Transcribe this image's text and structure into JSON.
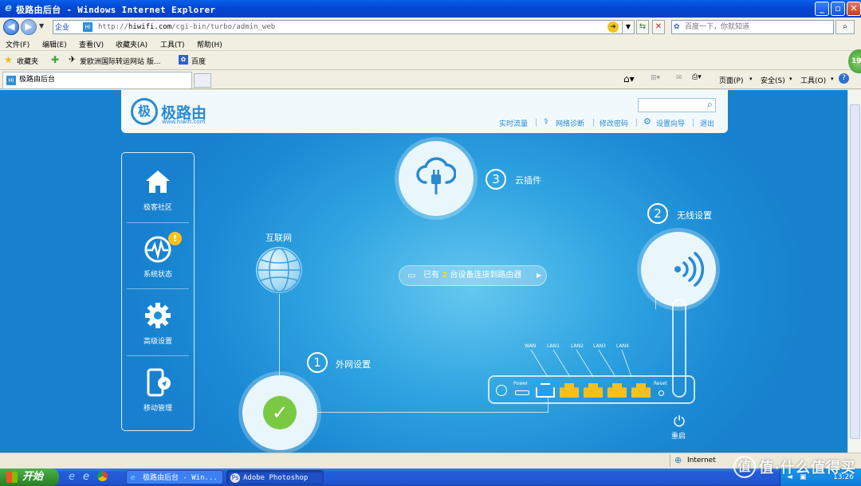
{
  "window": {
    "title": "极路由后台 - Windows Internet Explorer"
  },
  "address": {
    "zone": "企业",
    "url_prefix": "http://",
    "url_host": "hiwifi.com",
    "url_path": "/cgi-bin/turbo/admin_web",
    "search_placeholder": "百度一下，你就知道"
  },
  "menu": [
    "文件(F)",
    "编辑(E)",
    "查看(V)",
    "收藏夹(A)",
    "工具(T)",
    "帮助(H)"
  ],
  "favorites": {
    "label": "收藏夹",
    "items": [
      "爱欧洲国际转运网站 版...",
      "百度"
    ]
  },
  "tab": {
    "title": "极路由后台"
  },
  "commandbar": [
    "页面(P)",
    "安全(S)",
    "工具(O)"
  ],
  "page": {
    "brand": "极路由",
    "brand_url": "www.hiwifi.com",
    "header_links": [
      "实时流量",
      "网络诊断",
      "修改密码",
      "设置向导",
      "退出"
    ],
    "sidebar": [
      {
        "label": "极客社区",
        "icon": "home-icon"
      },
      {
        "label": "系统状态",
        "icon": "status-monitor-icon"
      },
      {
        "label": "高级设置",
        "icon": "gear-icon"
      },
      {
        "label": "移动管理",
        "icon": "mobile-icon"
      }
    ],
    "steps": [
      {
        "num": "1",
        "label": "外网设置"
      },
      {
        "num": "2",
        "label": "无线设置"
      },
      {
        "num": "3",
        "label": "云插件"
      }
    ],
    "internet_label": "互联网",
    "devices_text_before": "已有",
    "devices_count": "2",
    "devices_text_after": "台设备连接到路由器",
    "router": {
      "power": "Power",
      "reset": "Reset",
      "ports": [
        "WAN",
        "LAN1",
        "LAN2",
        "LAN3",
        "LAN4"
      ]
    },
    "restart_label": "重启",
    "colors": {
      "background": "#1b8ad4",
      "check": "#7ac943",
      "port_wan": "#2a9de8",
      "port_lan": "#f4c01e"
    }
  },
  "statusbar": {
    "zone": "Internet"
  },
  "taskbar": {
    "start": "开始",
    "tasks": [
      "极路由后台 - Win...",
      "Adobe Photoshop"
    ],
    "time": "13:26"
  },
  "watermark": "值·什么值得买",
  "side_badge": "19"
}
